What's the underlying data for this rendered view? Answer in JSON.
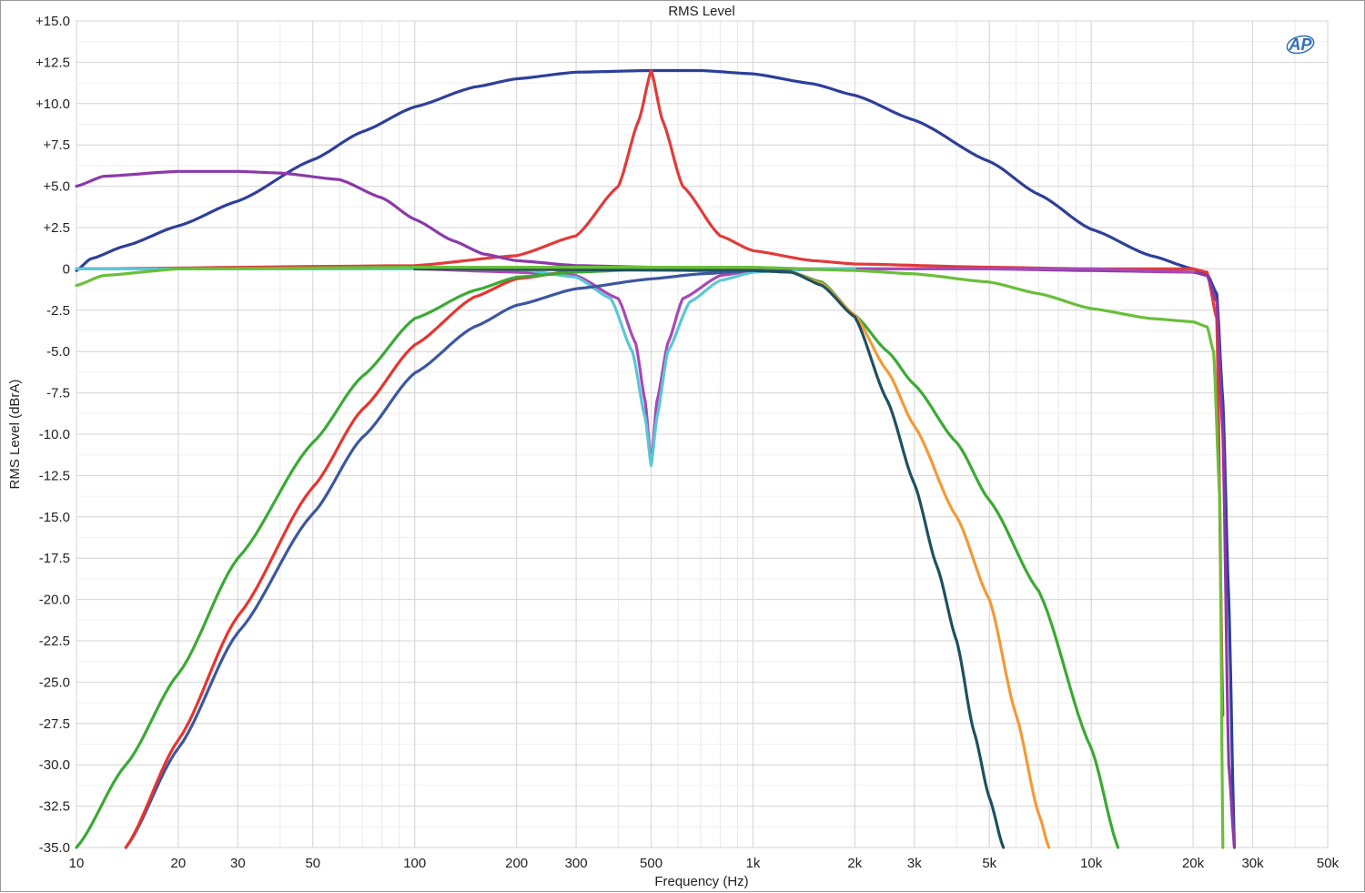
{
  "chart_data": {
    "type": "line",
    "title": "RMS Level",
    "xlabel": "Frequency (Hz)",
    "ylabel": "RMS Level (dBrA)",
    "x_scale": "log",
    "xlim": [
      10,
      50000
    ],
    "ylim": [
      -35,
      15
    ],
    "grid": true,
    "legend": "none",
    "logo": "AP",
    "x_ticks": [
      {
        "v": 10,
        "label": "10"
      },
      {
        "v": 20,
        "label": "20"
      },
      {
        "v": 30,
        "label": "30"
      },
      {
        "v": 50,
        "label": "50"
      },
      {
        "v": 100,
        "label": "100"
      },
      {
        "v": 200,
        "label": "200"
      },
      {
        "v": 300,
        "label": "300"
      },
      {
        "v": 500,
        "label": "500"
      },
      {
        "v": 1000,
        "label": "1k"
      },
      {
        "v": 2000,
        "label": "2k"
      },
      {
        "v": 3000,
        "label": "3k"
      },
      {
        "v": 5000,
        "label": "5k"
      },
      {
        "v": 10000,
        "label": "10k"
      },
      {
        "v": 20000,
        "label": "20k"
      },
      {
        "v": 30000,
        "label": "30k"
      },
      {
        "v": 50000,
        "label": "50k"
      }
    ],
    "y_ticks": [
      {
        "v": 15,
        "label": "+15.0"
      },
      {
        "v": 12.5,
        "label": "+12.5"
      },
      {
        "v": 10,
        "label": "+10.0"
      },
      {
        "v": 7.5,
        "label": "+7.5"
      },
      {
        "v": 5,
        "label": "+5.0"
      },
      {
        "v": 2.5,
        "label": "+2.5"
      },
      {
        "v": 0,
        "label": "0"
      },
      {
        "v": -2.5,
        "label": "-2.5"
      },
      {
        "v": -5,
        "label": "-5.0"
      },
      {
        "v": -7.5,
        "label": "-7.5"
      },
      {
        "v": -10,
        "label": "-10.0"
      },
      {
        "v": -12.5,
        "label": "-12.5"
      },
      {
        "v": -15,
        "label": "-15.0"
      },
      {
        "v": -17.5,
        "label": "-17.5"
      },
      {
        "v": -20,
        "label": "-20.0"
      },
      {
        "v": -22.5,
        "label": "-22.5"
      },
      {
        "v": -25,
        "label": "-25.0"
      },
      {
        "v": -27.5,
        "label": "-27.5"
      },
      {
        "v": -30,
        "label": "-30.0"
      },
      {
        "v": -32.5,
        "label": "-32.5"
      },
      {
        "v": -35,
        "label": "-35.0"
      }
    ],
    "series": [
      {
        "color": "#2e3f9a",
        "points": [
          [
            10,
            -0.1
          ],
          [
            11,
            0.6
          ],
          [
            14,
            1.4
          ],
          [
            20,
            2.6
          ],
          [
            30,
            4.1
          ],
          [
            50,
            6.6
          ],
          [
            70,
            8.3
          ],
          [
            100,
            9.8
          ],
          [
            150,
            11.0
          ],
          [
            200,
            11.5
          ],
          [
            300,
            11.9
          ],
          [
            500,
            12.0
          ],
          [
            700,
            12.0
          ],
          [
            1000,
            11.8
          ],
          [
            1500,
            11.2
          ],
          [
            2000,
            10.5
          ],
          [
            3000,
            9.0
          ],
          [
            5000,
            6.5
          ],
          [
            7000,
            4.5
          ],
          [
            10000,
            2.4
          ],
          [
            15000,
            0.8
          ],
          [
            20000,
            0.0
          ],
          [
            22000,
            -0.3
          ],
          [
            23500,
            -1.5
          ],
          [
            24500,
            -8
          ],
          [
            25500,
            -20
          ],
          [
            26500,
            -35
          ]
        ]
      },
      {
        "color": "#e23a3a",
        "points": [
          [
            10,
            0
          ],
          [
            100,
            0.2
          ],
          [
            200,
            0.8
          ],
          [
            300,
            2.0
          ],
          [
            400,
            5.0
          ],
          [
            460,
            9.0
          ],
          [
            500,
            12.0
          ],
          [
            540,
            9.0
          ],
          [
            620,
            5.0
          ],
          [
            800,
            2.0
          ],
          [
            1000,
            1.1
          ],
          [
            1500,
            0.5
          ],
          [
            2000,
            0.3
          ],
          [
            5000,
            0.1
          ],
          [
            10000,
            0.0
          ],
          [
            20000,
            0.0
          ],
          [
            22000,
            -0.2
          ],
          [
            23500,
            -3
          ],
          [
            24500,
            -27
          ]
        ]
      },
      {
        "color": "#8b3aa8",
        "points": [
          [
            10,
            5.0
          ],
          [
            12,
            5.6
          ],
          [
            20,
            5.9
          ],
          [
            30,
            5.9
          ],
          [
            40,
            5.8
          ],
          [
            60,
            5.4
          ],
          [
            80,
            4.3
          ],
          [
            100,
            3.0
          ],
          [
            130,
            1.7
          ],
          [
            160,
            0.9
          ],
          [
            200,
            0.5
          ],
          [
            300,
            0.2
          ],
          [
            500,
            0.1
          ],
          [
            1000,
            0.0
          ],
          [
            5000,
            0.0
          ],
          [
            10000,
            -0.1
          ],
          [
            20000,
            -0.2
          ],
          [
            22000,
            -0.4
          ],
          [
            23500,
            -2
          ],
          [
            24500,
            -10
          ],
          [
            25500,
            -30
          ],
          [
            26500,
            -35
          ]
        ]
      },
      {
        "color": "#a54ab5",
        "points": [
          [
            10,
            0
          ],
          [
            100,
            0
          ],
          [
            200,
            -0.2
          ],
          [
            300,
            -0.4
          ],
          [
            400,
            -1.8
          ],
          [
            450,
            -4.5
          ],
          [
            480,
            -8.0
          ],
          [
            500,
            -11.8
          ],
          [
            520,
            -8.0
          ],
          [
            560,
            -4.5
          ],
          [
            620,
            -1.8
          ],
          [
            800,
            -0.4
          ],
          [
            1000,
            -0.1
          ],
          [
            2000,
            0.0
          ],
          [
            10000,
            0.0
          ],
          [
            20000,
            -0.2
          ]
        ]
      },
      {
        "color": "#5cc6d6",
        "points": [
          [
            10,
            0
          ],
          [
            200,
            0
          ],
          [
            300,
            -0.5
          ],
          [
            380,
            -1.8
          ],
          [
            440,
            -5.0
          ],
          [
            480,
            -9.0
          ],
          [
            500,
            -11.9
          ],
          [
            520,
            -9.0
          ],
          [
            560,
            -5.0
          ],
          [
            650,
            -2.0
          ],
          [
            800,
            -0.7
          ],
          [
            1000,
            -0.2
          ],
          [
            1500,
            0.0
          ],
          [
            2000,
            0.0
          ]
        ]
      },
      {
        "color": "#3c57a0",
        "points": [
          [
            14,
            -35
          ],
          [
            20,
            -29
          ],
          [
            30,
            -22
          ],
          [
            50,
            -14.8
          ],
          [
            70,
            -10.2
          ],
          [
            100,
            -6.3
          ],
          [
            150,
            -3.5
          ],
          [
            200,
            -2.2
          ],
          [
            300,
            -1.2
          ],
          [
            500,
            -0.6
          ],
          [
            700,
            -0.3
          ],
          [
            1000,
            -0.1
          ],
          [
            1300,
            0.0
          ]
        ]
      },
      {
        "color": "#e8342e",
        "points": [
          [
            14,
            -35
          ],
          [
            20,
            -28.5
          ],
          [
            30,
            -21
          ],
          [
            50,
            -13.2
          ],
          [
            70,
            -8.5
          ],
          [
            100,
            -4.6
          ],
          [
            150,
            -1.7
          ],
          [
            200,
            -0.6
          ],
          [
            300,
            -0.1
          ],
          [
            500,
            0.0
          ],
          [
            1000,
            0.0
          ]
        ]
      },
      {
        "color": "#3aaa35",
        "points": [
          [
            10,
            -35
          ],
          [
            14,
            -30
          ],
          [
            20,
            -24.5
          ],
          [
            30,
            -17.5
          ],
          [
            50,
            -10.5
          ],
          [
            70,
            -6.5
          ],
          [
            100,
            -3.0
          ],
          [
            150,
            -1.3
          ],
          [
            200,
            -0.5
          ],
          [
            300,
            -0.2
          ],
          [
            500,
            0.0
          ],
          [
            1000,
            -0.1
          ],
          [
            1300,
            -0.2
          ],
          [
            1600,
            -0.8
          ],
          [
            2000,
            -2.8
          ],
          [
            2500,
            -5.0
          ],
          [
            3000,
            -7.0
          ],
          [
            4000,
            -10.5
          ],
          [
            5000,
            -14.0
          ],
          [
            7000,
            -19.5
          ],
          [
            10000,
            -29.0
          ],
          [
            12000,
            -35
          ]
        ]
      },
      {
        "color": "#f29a38",
        "points": [
          [
            100,
            0
          ],
          [
            1000,
            -0.1
          ],
          [
            1300,
            -0.2
          ],
          [
            1600,
            -0.9
          ],
          [
            2000,
            -2.8
          ],
          [
            2500,
            -6.2
          ],
          [
            3000,
            -9.5
          ],
          [
            4000,
            -15.0
          ],
          [
            5000,
            -20.0
          ],
          [
            6000,
            -27.0
          ],
          [
            7000,
            -33.0
          ],
          [
            7500,
            -35
          ]
        ]
      },
      {
        "color": "#1e5160",
        "points": [
          [
            100,
            0
          ],
          [
            1000,
            -0.1
          ],
          [
            1300,
            -0.2
          ],
          [
            1600,
            -1.0
          ],
          [
            2000,
            -2.9
          ],
          [
            2500,
            -8.0
          ],
          [
            3000,
            -13.0
          ],
          [
            3500,
            -18.0
          ],
          [
            4000,
            -22.5
          ],
          [
            4500,
            -28.0
          ],
          [
            5000,
            -32.0
          ],
          [
            5500,
            -35
          ]
        ]
      },
      {
        "color": "#6abf3a",
        "points": [
          [
            10,
            -1.0
          ],
          [
            12,
            -0.4
          ],
          [
            20,
            0.0
          ],
          [
            100,
            0.1
          ],
          [
            1000,
            0.1
          ],
          [
            2000,
            -0.1
          ],
          [
            3000,
            -0.3
          ],
          [
            5000,
            -0.8
          ],
          [
            7000,
            -1.5
          ],
          [
            10000,
            -2.4
          ],
          [
            15000,
            -3.0
          ],
          [
            20000,
            -3.2
          ],
          [
            22000,
            -3.5
          ],
          [
            23000,
            -5
          ],
          [
            24000,
            -14
          ],
          [
            24500,
            -35
          ]
        ]
      }
    ]
  }
}
